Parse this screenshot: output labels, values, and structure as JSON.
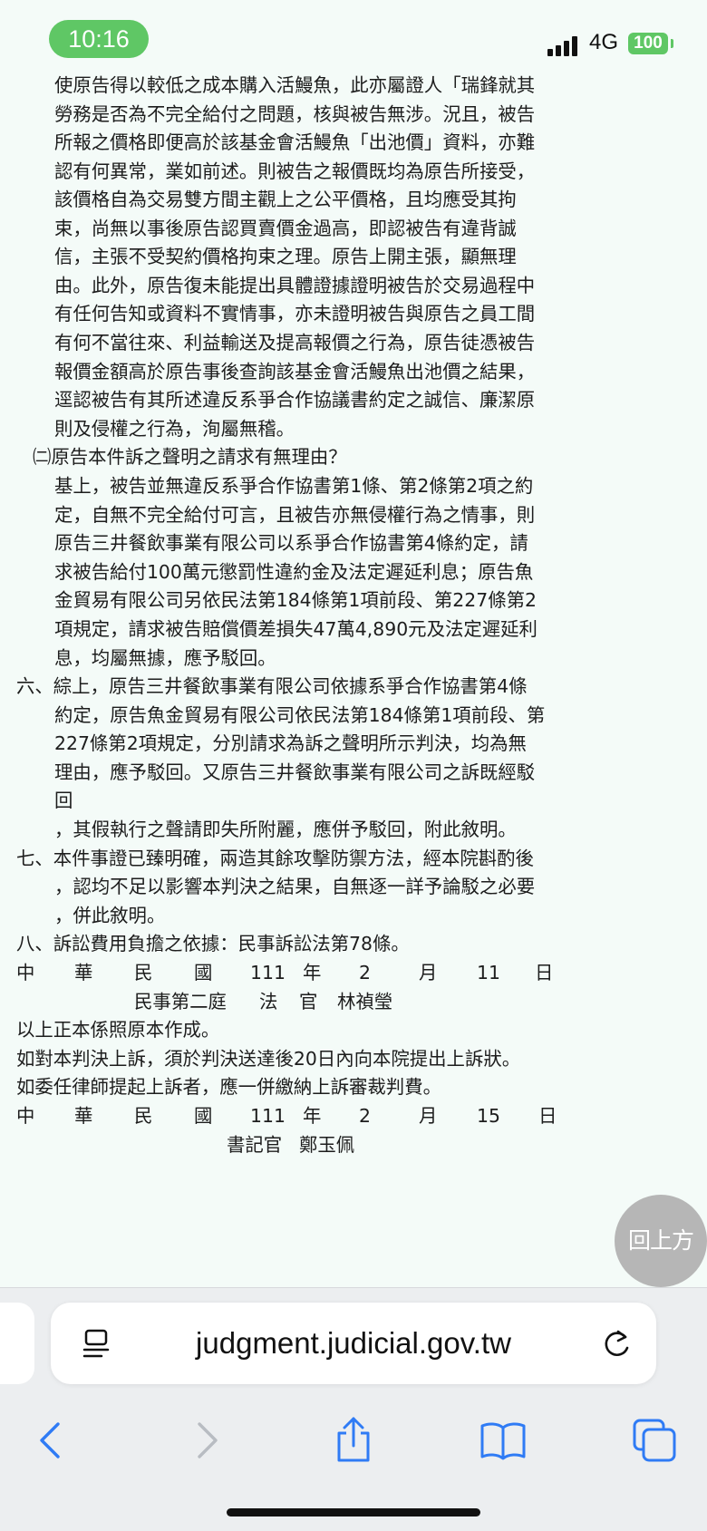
{
  "status": {
    "time": "10:16",
    "network": "4G",
    "battery": "100"
  },
  "document": {
    "lines": [
      "使原告得以較低之成本購入活鰻魚，此亦屬證人「瑞鋒就其",
      "勞務是否為不完全給付之問題，核與被告無涉。況且，被告",
      "所報之價格即便高於該基金會活鰻魚「出池價」資料，亦難",
      "認有何異常，業如前述。則被告之報價既均為原告所接受，",
      "該價格自為交易雙方間主觀上之公平價格，且均應受其拘",
      "束，尚無以事後原告認買賣價金過高，即認被告有違背誠",
      "信，主張不受契約價格拘束之理。原告上開主張，顯無理",
      "由。此外，原告復未能提出具體證據證明被告於交易過程中",
      "有任何告知或資料不實情事，亦未證明被告與原告之員工間",
      "有何不當往來、利益輸送及提高報價之行為，原告徒憑被告",
      "報價金額高於原告事後查詢該基金會活鰻魚出池價之結果，",
      "逕認被告有其所述違反系爭合作協議書約定之誠信、廉潔原",
      "則及侵權之行為，洵屬無稽。",
      "㈡原告本件訴之聲明之請求有無理由？",
      "基上，被告並無違反系爭合作協書第1條、第2條第2項之約",
      "定，自無不完全給付可言，且被告亦無侵權行為之情事，則",
      "原告三井餐飲事業有限公司以系爭合作協書第4條約定，請",
      "求被告給付100萬元懲罰性違約金及法定遲延利息；原告魚",
      "金貿易有限公司另依民法第184條第1項前段、第227條第2",
      "項規定，請求被告賠償價差損失47萬4,890元及法定遲延利",
      "息，均屬無據，應予駁回。",
      "六、綜上，原告三井餐飲事業有限公司依據系爭合作協書第4條",
      "約定，原告魚金貿易有限公司依民法第184條第1項前段、第",
      "227條第2項規定，分別請求為訴之聲明所示判決，均為無",
      "理由，應予駁回。又原告三井餐飲事業有限公司之訴既經駁",
      "回",
      "，其假執行之聲請即失所附麗，應併予駁回，附此敘明。",
      "七、本件事證已臻明確，兩造其餘攻擊防禦方法，經本院斟酌後",
      "，認均不足以影響本判決之結果，自無逐一詳予論駁之必要",
      "，併此敘明。",
      "八、訴訟費用負擔之依據：民事訴訟法第78條。"
    ],
    "date1": [
      "中",
      "華",
      "民",
      "國",
      "111",
      "年",
      "2",
      "月",
      "11",
      "日"
    ],
    "judge": [
      "民事第二庭",
      "法",
      "官",
      "林禎瑩"
    ],
    "copy_lines": [
      "以上正本係照原本作成。",
      "如對本判決上訴，須於判決送達後20日內向本院提出上訴狀。",
      "如委任律師提起上訴者，應一併繳納上訴審裁判費。"
    ],
    "date2": [
      "中",
      "華",
      "民",
      "國",
      "111",
      "年",
      "2",
      "月",
      "15",
      "日"
    ],
    "clerk": [
      "書記官",
      "鄭玉佩"
    ]
  },
  "back_to_top": "回上方",
  "browser": {
    "url": "judgment.judicial.gov.tw"
  }
}
